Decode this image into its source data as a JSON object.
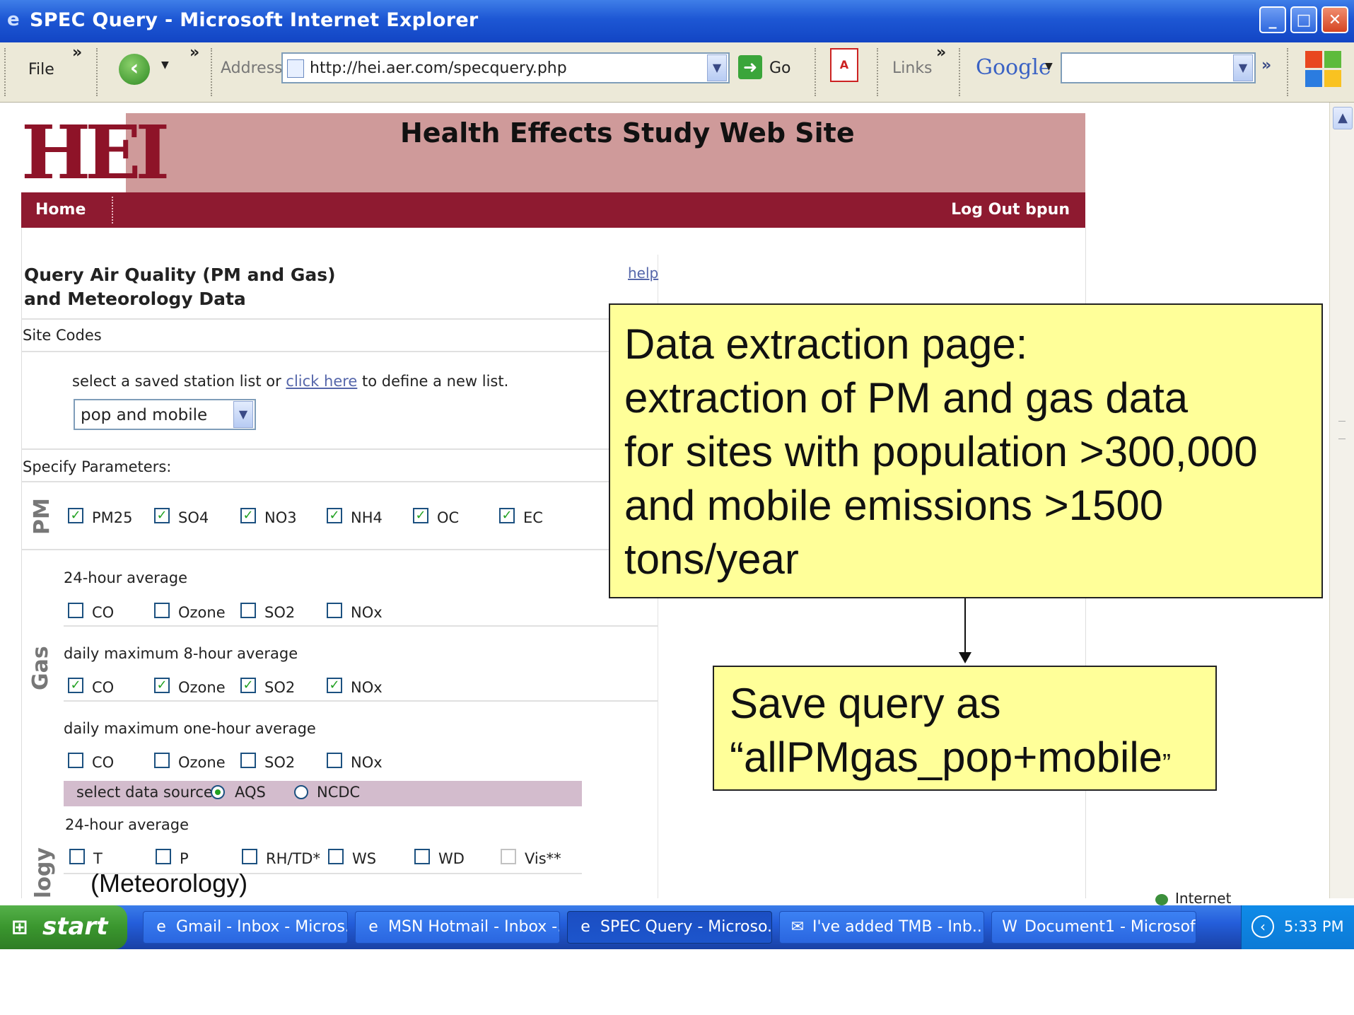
{
  "window": {
    "title": "SPEC Query - Microsoft Internet Explorer"
  },
  "toolbar": {
    "file_label": "File",
    "address_label": "Address",
    "url": "http://hei.aer.com/specquery.php",
    "go_label": "Go",
    "links_label": "Links",
    "google_label": "Google",
    "chevron": "»"
  },
  "page": {
    "site_title": "Health Effects Study Web Site",
    "logo_text": "HEI",
    "nav": {
      "home": "Home",
      "logout": "Log Out bpun"
    },
    "query_title_line1": "Query Air Quality (PM and Gas)",
    "query_title_line2": "and Meteorology Data",
    "help_link": "help",
    "site_codes_label": "Site Codes",
    "station_prompt_pre": "select a saved station list or ",
    "station_prompt_link": "click here",
    "station_prompt_post": " to define a new list.",
    "station_list_value": "pop and mobile",
    "specify_params_label": "Specify Parameters:",
    "pm_label": "PM",
    "pm_params": [
      {
        "label": "PM25",
        "checked": true
      },
      {
        "label": "SO4",
        "checked": true
      },
      {
        "label": "NO3",
        "checked": true
      },
      {
        "label": "NH4",
        "checked": true
      },
      {
        "label": "OC",
        "checked": true
      },
      {
        "label": "EC",
        "checked": true
      }
    ],
    "gas_label": "Gas",
    "gas_groups": [
      {
        "heading": "24-hour average",
        "items": [
          {
            "label": "CO",
            "checked": false
          },
          {
            "label": "Ozone",
            "checked": false
          },
          {
            "label": "SO2",
            "checked": false
          },
          {
            "label": "NOx",
            "checked": false
          }
        ]
      },
      {
        "heading": "daily maximum 8-hour average",
        "items": [
          {
            "label": "CO",
            "checked": true
          },
          {
            "label": "Ozone",
            "checked": true
          },
          {
            "label": "SO2",
            "checked": true
          },
          {
            "label": "NOx",
            "checked": true
          }
        ]
      },
      {
        "heading": "daily maximum one-hour average",
        "items": [
          {
            "label": "CO",
            "checked": false
          },
          {
            "label": "Ozone",
            "checked": false
          },
          {
            "label": "SO2",
            "checked": false
          },
          {
            "label": "NOx",
            "checked": false
          }
        ]
      }
    ],
    "data_source_label": "select data source:",
    "data_sources": [
      {
        "label": "AQS",
        "selected": true
      },
      {
        "label": "NCDC",
        "selected": false
      }
    ],
    "met_label": "logy",
    "met_heading": "24-hour average",
    "met_params": [
      {
        "label": "T",
        "checked": false
      },
      {
        "label": "P",
        "checked": false
      },
      {
        "label": "RH/TD*",
        "checked": false
      },
      {
        "label": "WS",
        "checked": false
      },
      {
        "label": "WD",
        "checked": false
      },
      {
        "label": "Vis**",
        "checked": false
      }
    ],
    "status_zone": "Internet"
  },
  "annotations": {
    "callout1": [
      "Data extraction page:",
      "extraction of PM and gas data",
      "for sites with population >300,000",
      "and mobile emissions >1500",
      "tons/year"
    ],
    "callout2_line1": "Save query as",
    "callout2_line2_main": "“allPMgas_pop+mobile",
    "callout2_line2_quote": "”",
    "meteorology_note": "(Meteorology)"
  },
  "taskbar": {
    "start_label": "start",
    "tasks": [
      {
        "label": "Gmail - Inbox - Micros...",
        "icon": "ie-icon",
        "active": false
      },
      {
        "label": "MSN Hotmail - Inbox -...",
        "icon": "ie-icon",
        "active": false
      },
      {
        "label": "SPEC Query - Microso...",
        "icon": "ie-icon",
        "active": true
      },
      {
        "label": "I've added TMB - Inb...",
        "icon": "mail-icon",
        "active": false
      },
      {
        "label": "Document1 - Microsof...",
        "icon": "word-icon",
        "active": false
      }
    ],
    "clock": "5:33 PM"
  },
  "colors": {
    "banner": "#cf9a9a",
    "navbar": "#8e1a30",
    "callout": "#ffff99",
    "taskbar": "#245edb"
  }
}
